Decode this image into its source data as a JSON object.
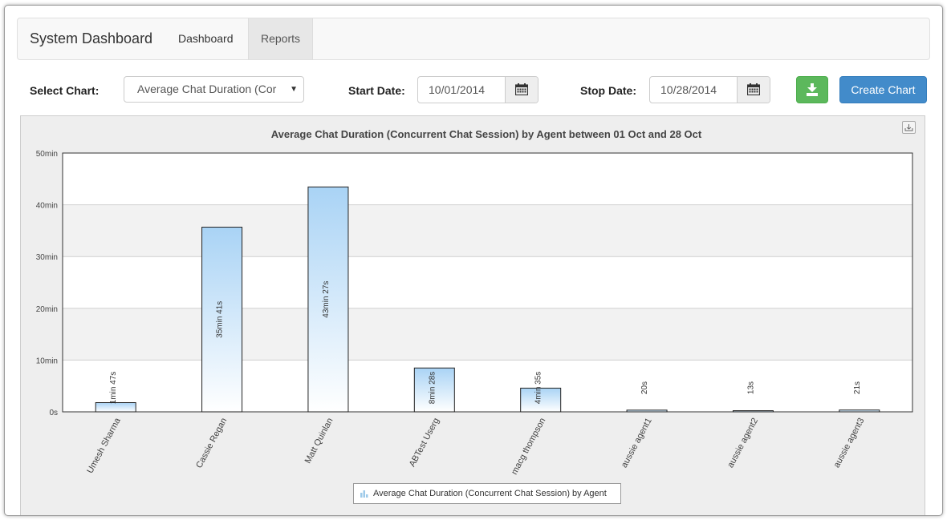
{
  "navbar": {
    "brand": "System Dashboard",
    "tabs": [
      {
        "label": "Dashboard",
        "active": false
      },
      {
        "label": "Reports",
        "active": true
      }
    ]
  },
  "controls": {
    "select_chart_label": "Select Chart:",
    "select_chart_value": "Average Chat Duration (Cor",
    "start_date_label": "Start Date:",
    "start_date_value": "10/01/2014",
    "stop_date_label": "Stop Date:",
    "stop_date_value": "10/28/2014",
    "download_icon": "download-icon",
    "create_chart_label": "Create Chart"
  },
  "colors": {
    "bar_top": "#a9d3f5",
    "bar_bottom": "#ffffff",
    "green_button": "#5cb85c",
    "blue_button": "#428bca"
  },
  "chart_data": {
    "type": "bar",
    "title": "Average Chat Duration (Concurrent Chat Session) by Agent between 01 Oct and 28 Oct",
    "xlabel": "",
    "ylabel": "",
    "ylim": [
      0,
      50
    ],
    "y_unit": "min",
    "y_ticks": [
      "0s",
      "10min",
      "20min",
      "30min",
      "40min",
      "50min"
    ],
    "categories": [
      "Umesh Sharma",
      "Cassie Regan",
      "Matt Quinlan",
      "ABTest Userg",
      "macg thompson",
      "aussie agent1",
      "aussie agent2",
      "aussie agent3"
    ],
    "values": [
      1.78,
      35.68,
      43.45,
      8.47,
      4.58,
      0.33,
      0.22,
      0.35
    ],
    "data_labels": [
      "1min 47s",
      "35min 41s",
      "43min 27s",
      "8min 28s",
      "4min 35s",
      "20s",
      "13s",
      "21s"
    ],
    "legend": [
      "Average Chat Duration (Concurrent Chat Session) by Agent"
    ],
    "legend_position": "bottom-center",
    "grid": true
  }
}
